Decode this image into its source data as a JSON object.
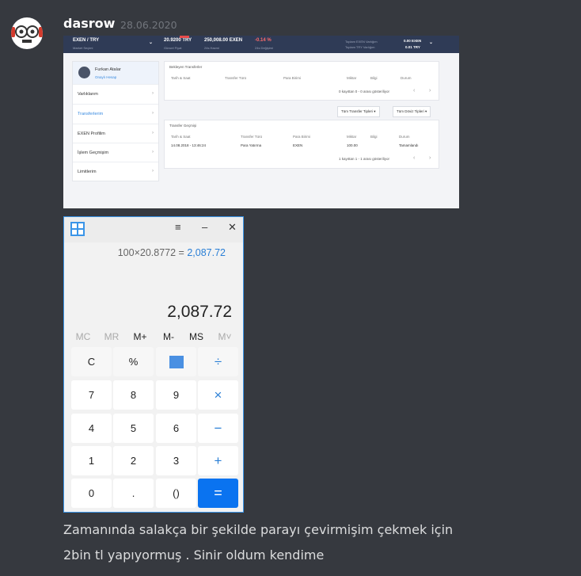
{
  "message": {
    "username": "dasrow",
    "timestamp": "28.06.2020",
    "text_line1": "Zamanında salakça bir şekilde parayı çevirmişim çekmek için",
    "text_line2": "2bin tl yapıyormuş . Sinir oldum kendime"
  },
  "exchange": {
    "pair": "EXEN / TRY",
    "pair_sub": "Market Seçimi",
    "price": "20.9200 TRY",
    "price_sub": "Güncel Fiyat",
    "volume": "250,008.00 EXEN",
    "volume_sub": "24s Hacmi",
    "change": "-0.14 %",
    "change_sub": "24s Değişimi",
    "total_exen_label": "Toplam EXEN Varlığım",
    "total_exen_value": "0.00 EXEN",
    "total_try_label": "Toplam TRY Varlığım",
    "total_try_value": "0.01 TRY",
    "user_name": "Furkan Atalar",
    "user_sub": "Onaylı Hesap",
    "menu": [
      "Varlıklarım",
      "Transferlerim",
      "EXEN Profilim",
      "İşlem Geçmişim",
      "Limitlerim"
    ],
    "pending_title": "Bekleyen Transferler",
    "headers": [
      "Tarih & Saat",
      "Transfer Türü",
      "Para Birimi",
      "Miktar",
      "Bilgi",
      "Durum"
    ],
    "pending_footer": "0 kayıttan 0 - 0 arası gösteriliyor",
    "filter1": "Tüm Transfer Tipleri",
    "filter2": "Tüm Döviz Tipleri",
    "history_title": "Transfer Geçmişi",
    "history_row": [
      "14.08.2018 - 13:46:24",
      "Para Yatırma",
      "EXEN",
      "100.00",
      "",
      "Tamamlandı"
    ],
    "history_footer": "1 kayıttan 1 - 1 arası gösteriliyor"
  },
  "calculator": {
    "expression": "100×20.8772 =",
    "expression_result": "2,087.72",
    "display": "2,087.72",
    "memory": [
      "MC",
      "MR",
      "M+",
      "M-",
      "MS",
      "M˅"
    ],
    "menu_icon": "≡",
    "minimize_icon": "–",
    "close_icon": "✕",
    "keys": [
      "C",
      "%",
      "",
      "÷",
      "7",
      "8",
      "9",
      "×",
      "4",
      "5",
      "6",
      "−",
      "1",
      "2",
      "3",
      "+",
      "0",
      ".",
      "()",
      "="
    ]
  }
}
